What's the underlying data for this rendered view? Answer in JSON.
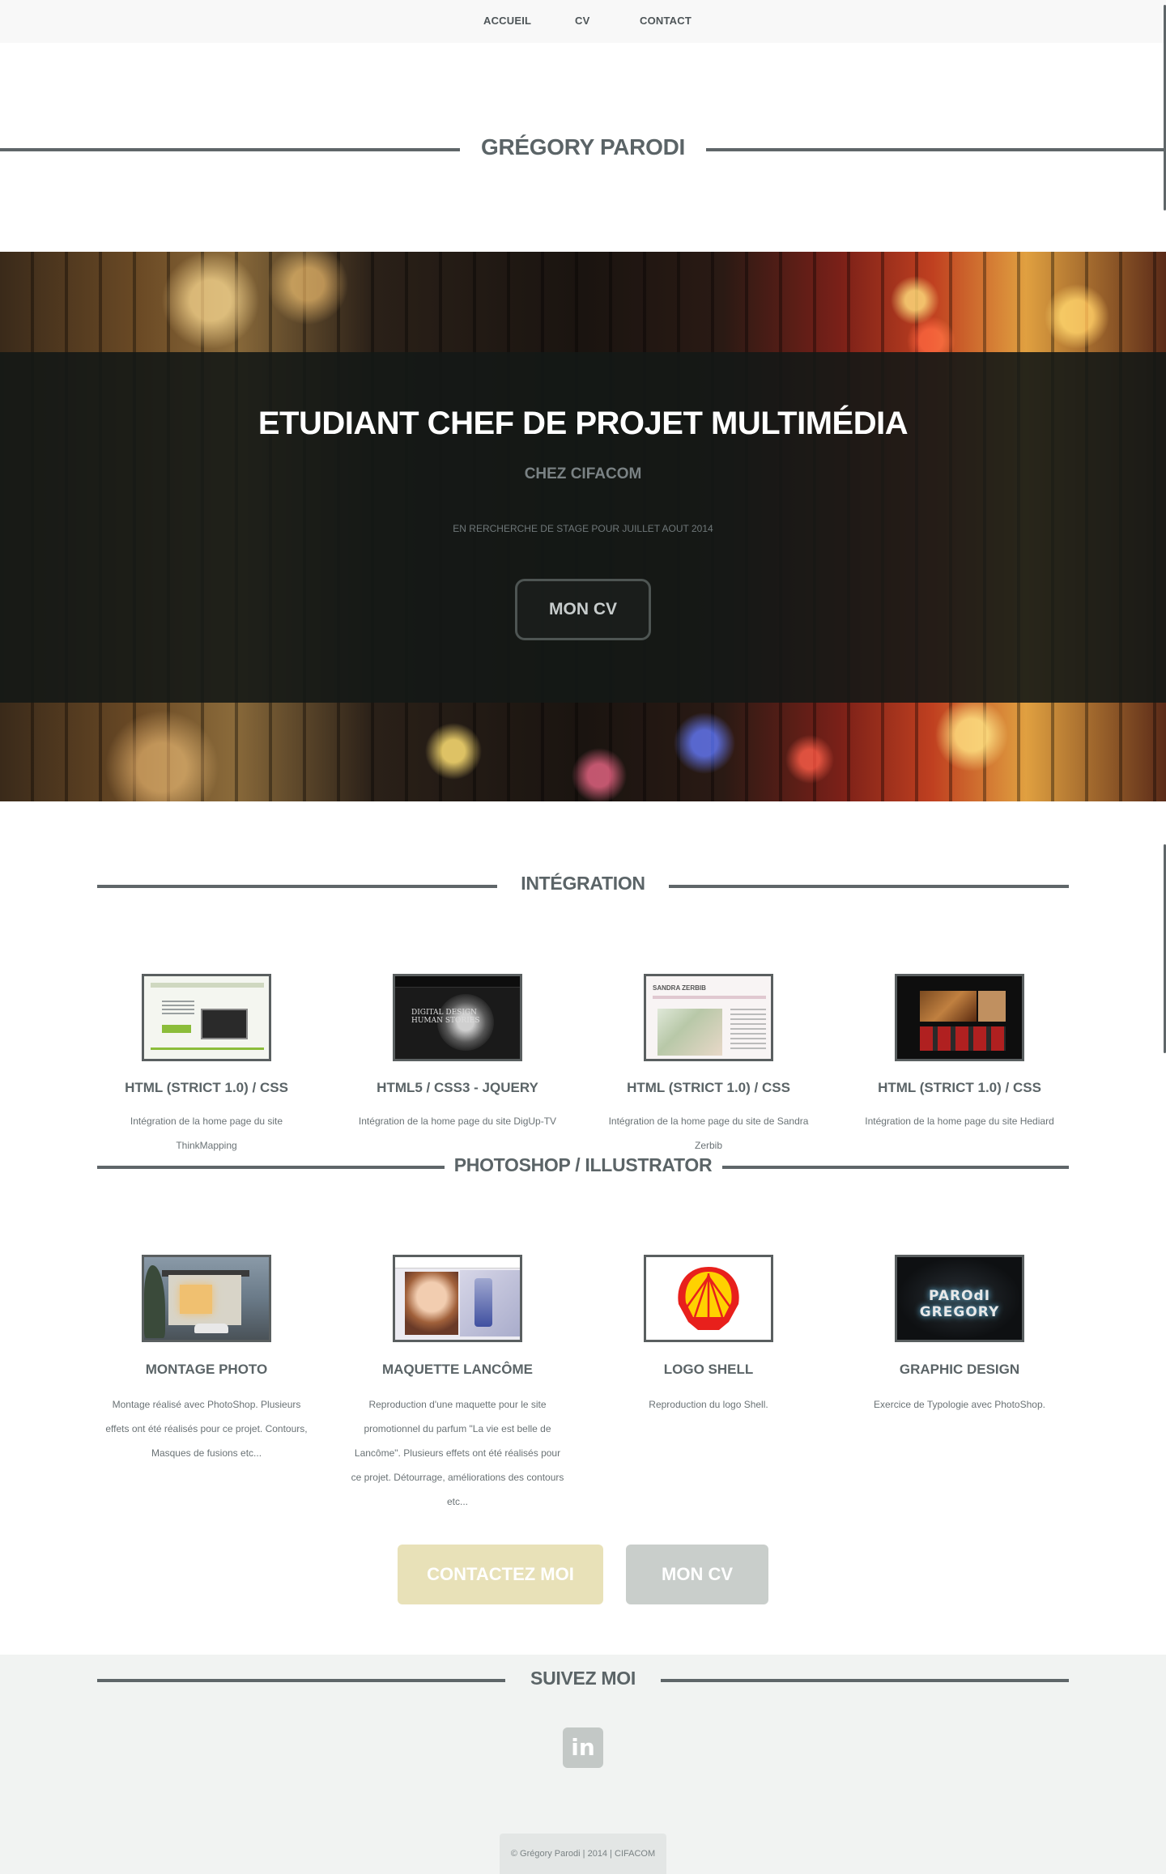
{
  "nav": {
    "items": [
      {
        "label": "ACCUEIL"
      },
      {
        "label": "CV"
      },
      {
        "label": "CONTACT"
      }
    ]
  },
  "site_title": "GRÉGORY PARODI",
  "hero": {
    "title": "ETUDIANT CHEF DE PROJET MULTIMÉDIA",
    "subtitle": "CHEZ CIFACOM",
    "note": "EN RERCHERCHE DE STAGE POUR JUILLET AOUT 2014",
    "button_label": "MON CV"
  },
  "sections": {
    "integration": {
      "heading": "INTÉGRATION",
      "items": [
        {
          "title": "HTML (STRICT 1.0) / CSS",
          "desc": "Intégration de la home page du site ThinkMapping"
        },
        {
          "title": "HTML5 / CSS3 - JQUERY",
          "desc": "Intégration de la home page du site DigUp-TV"
        },
        {
          "title": "HTML (STRICT 1.0) / CSS",
          "desc": "Intégration de la home page du site de Sandra Zerbib"
        },
        {
          "title": "HTML (STRICT 1.0) / CSS",
          "desc": "Intégration de la home page du site Hediard"
        }
      ]
    },
    "photoshop": {
      "heading": "PHOTOSHOP / ILLUSTRATOR",
      "items": [
        {
          "title": "MONTAGE PHOTO",
          "desc": "Montage réalisé avec PhotoShop. Plusieurs effets ont été réalisés pour ce projet. Contours, Masques de fusions etc..."
        },
        {
          "title": "MAQUETTE LANCÔME",
          "desc": "Reproduction d'une maquette pour le site promotionnel du parfum \"La vie est belle de Lancôme\". Plusieurs effets ont été réalisés pour ce projet. Détourrage, améliorations des contours etc..."
        },
        {
          "title": "LOGO SHELL",
          "desc": "Reproduction du logo Shell."
        },
        {
          "title": "GRAPHIC DESIGN",
          "desc": "Exercice de Typologie avec PhotoShop."
        }
      ]
    }
  },
  "thumbnails": {
    "digup_text": "DIGITAL DESIGN HUMAN STORIES",
    "graphic_text": "PAROdI GREGORY"
  },
  "cta": {
    "contact_label": "CONTACTEZ MOI",
    "cv_label": "MON CV"
  },
  "footer": {
    "heading": "SUIVEZ MOI",
    "social_icon": "linkedin-icon",
    "social_glyph": "in",
    "copyright": "© Grégory Parodi | 2014 | CIFACOM"
  },
  "colors": {
    "heading": "#5b6467",
    "line": "#5f6669",
    "contact_button": "#e8e1b8",
    "cv_button": "#c9cecb",
    "footer_bg": "#f1f3f2"
  }
}
